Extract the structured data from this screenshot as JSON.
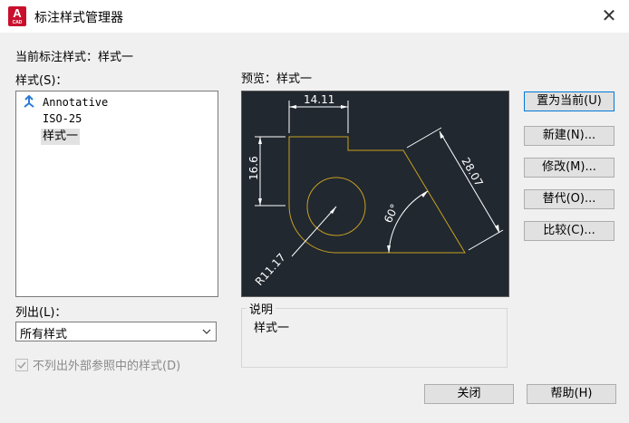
{
  "window": {
    "title": "标注样式管理器",
    "app_icon_letter": "A",
    "app_icon_sub": "CAD",
    "close_glyph": "✕"
  },
  "current_style": {
    "label": "当前标注样式：样式一"
  },
  "styles": {
    "label": "样式(S)：",
    "items": [
      {
        "label": "Annotative",
        "icon": "annotative-icon"
      },
      {
        "label": "ISO-25"
      },
      {
        "label": "样式一",
        "selected": true
      }
    ]
  },
  "list_filter": {
    "label": "列出(L)：",
    "selected": "所有样式"
  },
  "xref_checkbox": {
    "label": "不列出外部参照中的样式(D)",
    "checked": true,
    "disabled": true
  },
  "preview": {
    "label": "预览：样式一",
    "dims": {
      "top": "14.11",
      "left": "16.6",
      "diagonal": "28.07",
      "angle": "60°",
      "radius": "R11.17"
    }
  },
  "description": {
    "legend": "说明",
    "text": "样式一"
  },
  "buttons": {
    "set_current": "置为当前(U)",
    "new": "新建(N)...",
    "modify": "修改(M)...",
    "override": "替代(O)...",
    "compare": "比较(C)...",
    "close": "关闭",
    "help": "帮助(H)"
  },
  "colors": {
    "preview_bg": "#212830",
    "geometry": "#c8a020",
    "dimension": "#ffffff",
    "app_icon": "#c8102e"
  }
}
